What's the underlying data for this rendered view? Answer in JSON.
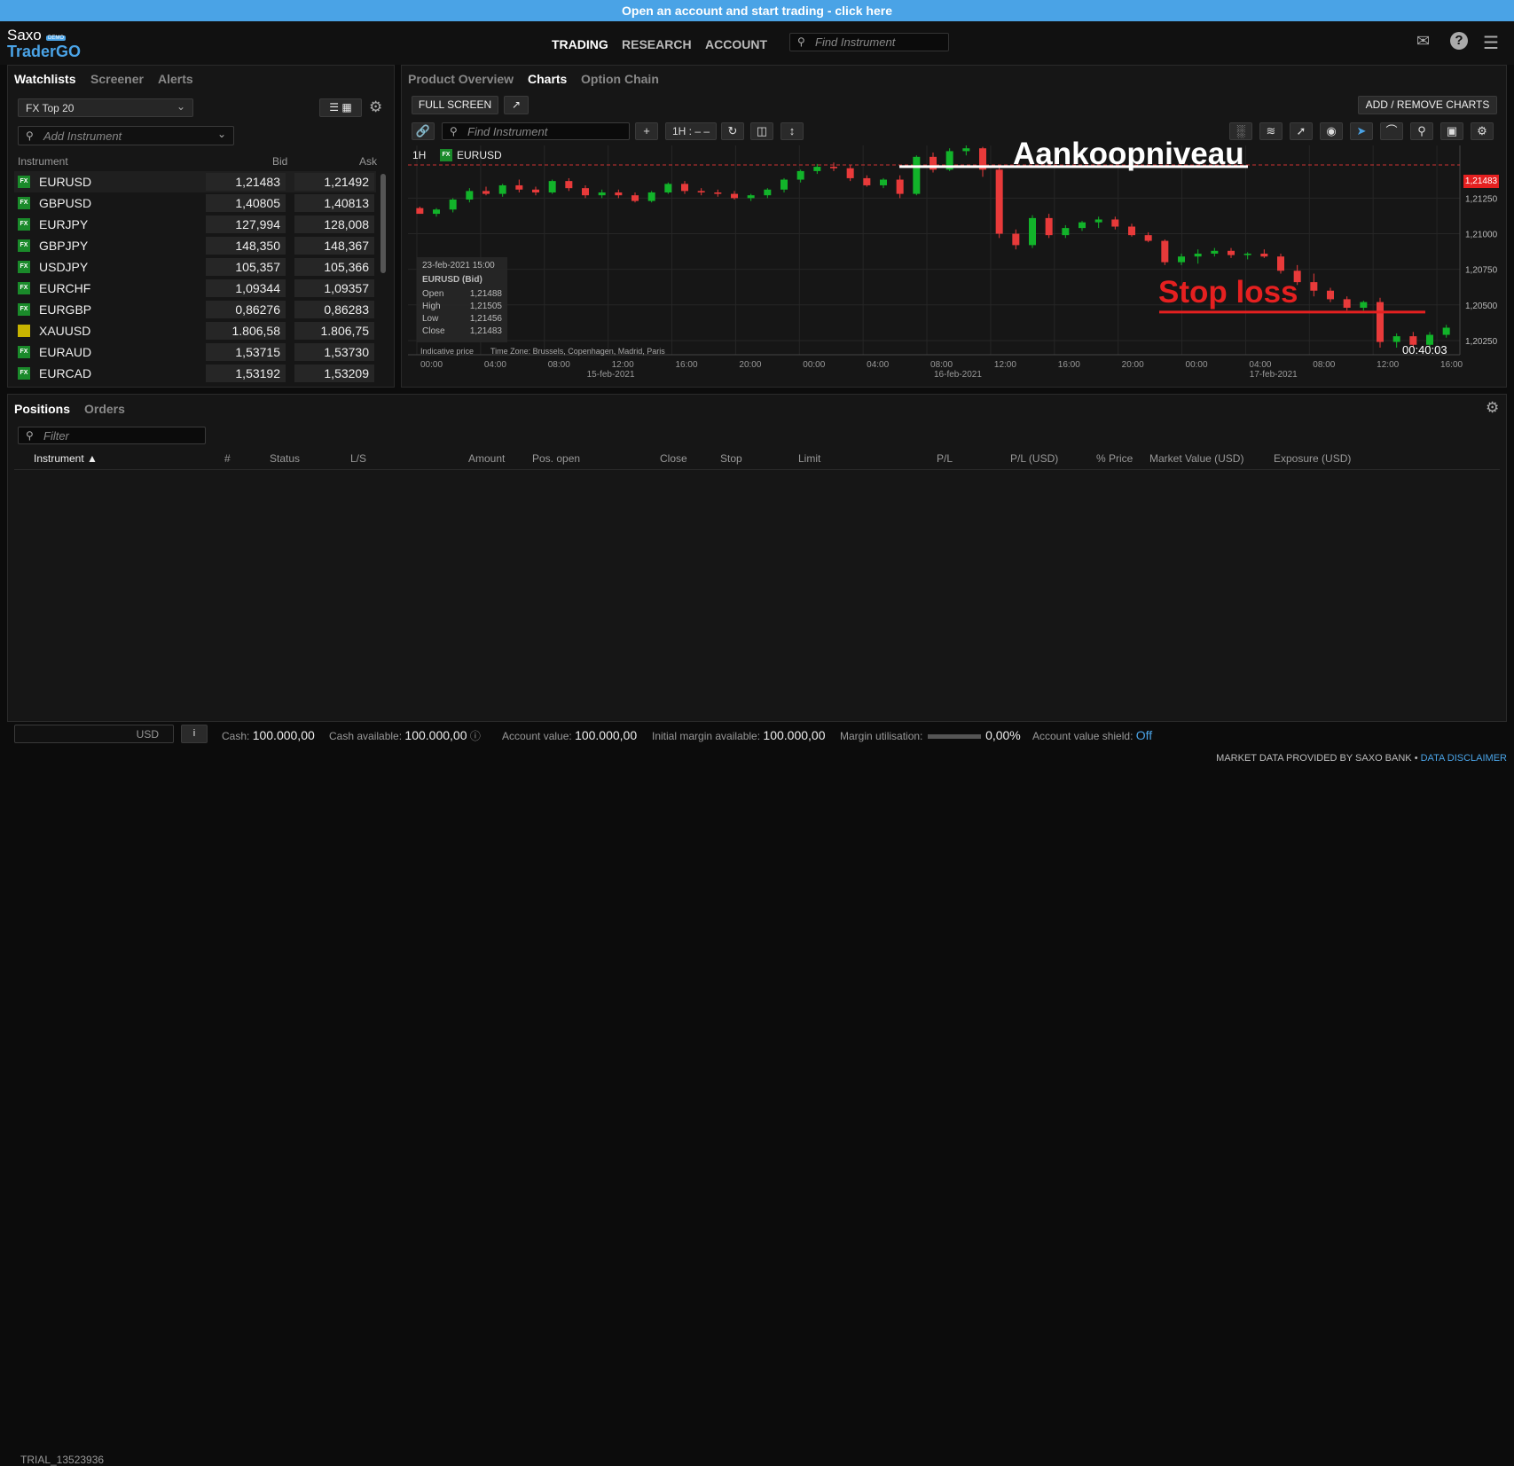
{
  "banner": "Open an account and start trading - click here",
  "logo": {
    "line1": "Saxo",
    "badge": "DEMO",
    "line2": "TraderGO"
  },
  "nav": [
    "TRADING",
    "RESEARCH",
    "ACCOUNT"
  ],
  "header_search_placeholder": "Find Instrument",
  "left_tabs": [
    "Watchlists",
    "Screener",
    "Alerts"
  ],
  "watchlist_select": "FX Top 20",
  "add_instrument_placeholder": "Add Instrument",
  "wl_columns": [
    "Instrument",
    "Bid",
    "Ask"
  ],
  "watchlist": [
    {
      "type": "FX",
      "name": "EURUSD",
      "bid": "1,21483",
      "ask": "1,21492"
    },
    {
      "type": "FX",
      "name": "GBPUSD",
      "bid": "1,40805",
      "ask": "1,40813"
    },
    {
      "type": "FX",
      "name": "EURJPY",
      "bid": "127,994",
      "ask": "128,008"
    },
    {
      "type": "FX",
      "name": "GBPJPY",
      "bid": "148,350",
      "ask": "148,367"
    },
    {
      "type": "FX",
      "name": "USDJPY",
      "bid": "105,357",
      "ask": "105,366"
    },
    {
      "type": "FX",
      "name": "EURCHF",
      "bid": "1,09344",
      "ask": "1,09357"
    },
    {
      "type": "FX",
      "name": "EURGBP",
      "bid": "0,86276",
      "ask": "0,86283"
    },
    {
      "type": "GOLD",
      "name": "XAUUSD",
      "bid": "1.806,58",
      "ask": "1.806,75"
    },
    {
      "type": "FX",
      "name": "EURAUD",
      "bid": "1,53715",
      "ask": "1,53730"
    },
    {
      "type": "FX",
      "name": "EURCAD",
      "bid": "1,53192",
      "ask": "1,53209"
    }
  ],
  "chart_tabs": [
    "Product Overview",
    "Charts",
    "Option Chain"
  ],
  "full_screen": "FULL SCREEN",
  "add_remove_charts": "ADD / REMOVE CHARTS",
  "chart_find_placeholder": "Find Instrument",
  "timeframe_button": "1H : – –",
  "chart_label": {
    "tf": "1H",
    "badge": "FX",
    "symbol": "EURUSD"
  },
  "chart_data": {
    "type": "candlestick",
    "symbol": "EURUSD",
    "interval": "1H",
    "ylim": [
      1.2015,
      1.2162
    ],
    "yticks": [
      "1,21250",
      "1,21000",
      "1,20750",
      "1,20500",
      "1,20250"
    ],
    "ytick_values": [
      1.2125,
      1.21,
      1.2075,
      1.205,
      1.2025
    ],
    "xticks": [
      "00:00",
      "04:00",
      "08:00",
      "12:00",
      "16:00",
      "20:00",
      "00:00",
      "04:00",
      "08:00",
      "12:00",
      "16:00",
      "20:00",
      "00:00",
      "04:00",
      "08:00",
      "12:00",
      "16:00"
    ],
    "dates": [
      "15-feb-2021",
      "16-feb-2021",
      "17-feb-2021"
    ],
    "current_price": "1,21483",
    "current_value": 1.21483,
    "countdown": "00:40:03",
    "annotations": [
      "Aankoopniveau",
      "Stop loss"
    ],
    "buy_level": 1.2149,
    "stop_level": 1.2045,
    "candles": [
      [
        1.2118,
        1.2119,
        1.2114,
        1.2114
      ],
      [
        1.2114,
        1.2118,
        1.2112,
        1.2117
      ],
      [
        1.2117,
        1.2125,
        1.2115,
        1.2124
      ],
      [
        1.2124,
        1.2132,
        1.2122,
        1.213
      ],
      [
        1.213,
        1.2133,
        1.2127,
        1.2128
      ],
      [
        1.2128,
        1.2135,
        1.2126,
        1.2134
      ],
      [
        1.2134,
        1.2138,
        1.2129,
        1.2131
      ],
      [
        1.2131,
        1.2133,
        1.2127,
        1.2129
      ],
      [
        1.2129,
        1.2138,
        1.2128,
        1.2137
      ],
      [
        1.2137,
        1.2139,
        1.213,
        1.2132
      ],
      [
        1.2132,
        1.2134,
        1.2125,
        1.2127
      ],
      [
        1.2127,
        1.2131,
        1.2125,
        1.2129
      ],
      [
        1.2129,
        1.2131,
        1.2125,
        1.2127
      ],
      [
        1.2127,
        1.2129,
        1.2122,
        1.2123
      ],
      [
        1.2123,
        1.213,
        1.2122,
        1.2129
      ],
      [
        1.2129,
        1.2136,
        1.2128,
        1.2135
      ],
      [
        1.2135,
        1.2137,
        1.2128,
        1.213
      ],
      [
        1.213,
        1.2132,
        1.2127,
        1.2129
      ],
      [
        1.2129,
        1.2131,
        1.2126,
        1.2128
      ],
      [
        1.2128,
        1.213,
        1.2124,
        1.2125
      ],
      [
        1.2125,
        1.2128,
        1.2123,
        1.2127
      ],
      [
        1.2127,
        1.2132,
        1.2125,
        1.2131
      ],
      [
        1.2131,
        1.2139,
        1.2129,
        1.2138
      ],
      [
        1.2138,
        1.2145,
        1.2136,
        1.2144
      ],
      [
        1.2144,
        1.2149,
        1.2142,
        1.2147
      ],
      [
        1.2147,
        1.215,
        1.2144,
        1.2146
      ],
      [
        1.2146,
        1.2148,
        1.2137,
        1.2139
      ],
      [
        1.2139,
        1.2141,
        1.2133,
        1.2134
      ],
      [
        1.2134,
        1.2139,
        1.2132,
        1.2138
      ],
      [
        1.2138,
        1.2141,
        1.2125,
        1.2128
      ],
      [
        1.2128,
        1.2155,
        1.2127,
        1.2154
      ],
      [
        1.2154,
        1.2157,
        1.2143,
        1.2145
      ],
      [
        1.2145,
        1.216,
        1.2144,
        1.2158
      ],
      [
        1.2158,
        1.2162,
        1.2155,
        1.216
      ],
      [
        1.216,
        1.2161,
        1.214,
        1.2145
      ],
      [
        1.2145,
        1.2147,
        1.2097,
        1.21
      ],
      [
        1.21,
        1.2103,
        1.2089,
        1.2092
      ],
      [
        1.2092,
        1.2113,
        1.209,
        1.2111
      ],
      [
        1.2111,
        1.2114,
        1.2097,
        1.2099
      ],
      [
        1.2099,
        1.2106,
        1.2097,
        1.2104
      ],
      [
        1.2104,
        1.2109,
        1.2102,
        1.2108
      ],
      [
        1.2108,
        1.2112,
        1.2104,
        1.211
      ],
      [
        1.211,
        1.2112,
        1.2103,
        1.2105
      ],
      [
        1.2105,
        1.2107,
        1.2098,
        1.2099
      ],
      [
        1.2099,
        1.2101,
        1.2094,
        1.2095
      ],
      [
        1.2095,
        1.2096,
        1.2078,
        1.208
      ],
      [
        1.208,
        1.2086,
        1.2078,
        1.2084
      ],
      [
        1.2084,
        1.2089,
        1.2079,
        1.2086
      ],
      [
        1.2086,
        1.209,
        1.2084,
        1.2088
      ],
      [
        1.2088,
        1.209,
        1.2083,
        1.2085
      ],
      [
        1.2085,
        1.2087,
        1.2082,
        1.2086
      ],
      [
        1.2086,
        1.2089,
        1.2083,
        1.2084
      ],
      [
        1.2084,
        1.2086,
        1.2072,
        1.2074
      ],
      [
        1.2074,
        1.2078,
        1.2064,
        1.2066
      ],
      [
        1.2066,
        1.2072,
        1.2056,
        1.206
      ],
      [
        1.206,
        1.2062,
        1.2052,
        1.2054
      ],
      [
        1.2054,
        1.2056,
        1.2046,
        1.2048
      ],
      [
        1.2048,
        1.2053,
        1.2046,
        1.2052
      ],
      [
        1.2052,
        1.2055,
        1.202,
        1.2024
      ],
      [
        1.2024,
        1.203,
        1.202,
        1.2028
      ],
      [
        1.2028,
        1.2031,
        1.202,
        1.2022
      ],
      [
        1.2022,
        1.2031,
        1.2019,
        1.2029
      ],
      [
        1.2029,
        1.2036,
        1.2027,
        1.2034
      ]
    ]
  },
  "tooltip": {
    "time": "23-feb-2021 15:00",
    "title": "EURUSD (Bid)",
    "rows": [
      [
        "Open",
        "1,21488"
      ],
      [
        "High",
        "1,21505"
      ],
      [
        "Low",
        "1,21456"
      ],
      [
        "Close",
        "1,21483"
      ]
    ]
  },
  "chart_footer": {
    "indicative": "Indicative price",
    "timezone": "Time Zone: Brussels, Copenhagen, Madrid, Paris"
  },
  "bottom_tabs": [
    "Positions",
    "Orders"
  ],
  "filter_placeholder": "Filter",
  "pos_columns": [
    "Instrument ▲",
    "#",
    "Status",
    "L/S",
    "Amount",
    "Pos. open",
    "Close",
    "Stop",
    "Limit",
    "P/L",
    "P/L (USD)",
    "% Price",
    "Market Value (USD)",
    "Exposure (USD)"
  ],
  "account": {
    "id": "TRIAL_13523936",
    "currency": "USD",
    "info": "i"
  },
  "stats": [
    {
      "label": "Cash:",
      "value": "100.000,00"
    },
    {
      "label": "Cash available:",
      "value": "100.000,00"
    },
    {
      "label": "Account value:",
      "value": "100.000,00"
    },
    {
      "label": "Initial margin available:",
      "value": "100.000,00"
    },
    {
      "label": "Margin utilisation:",
      "value": "0,00%"
    },
    {
      "label": "Account value shield:",
      "value": "Off"
    }
  ],
  "footer": {
    "text": "MARKET DATA PROVIDED BY SAXO BANK •",
    "link": "DATA DISCLAIMER"
  }
}
